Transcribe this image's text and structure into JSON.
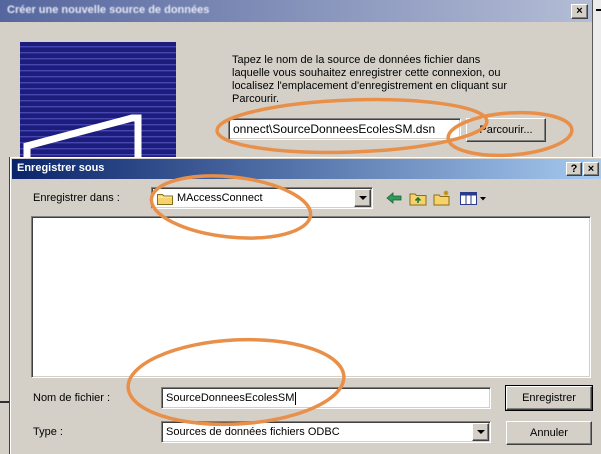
{
  "back_dialog": {
    "title": "Créer une nouvelle source de données",
    "close_glyph": "×",
    "illustration_icon": "wizard-illustration",
    "instructions": [
      "Tapez le nom de la source de données fichier dans",
      "laquelle vous souhaitez enregistrer cette connexion, ou",
      "localisez l'emplacement d'enregistrement en cliquant sur",
      "Parcourir."
    ],
    "path_value": "onnect\\SourceDonneesEcolesSM.dsn",
    "browse_label": "Parcourir..."
  },
  "save_dialog": {
    "title": "Enregistrer sous",
    "help_glyph": "?",
    "close_glyph": "×",
    "save_in": {
      "label": "Enregistrer dans :",
      "value": "MAccessConnect",
      "icon": "folder-icon"
    },
    "toolbar": [
      {
        "icon": "back-arrow-icon"
      },
      {
        "icon": "up-folder-icon"
      },
      {
        "icon": "new-folder-icon"
      },
      {
        "icon": "view-menu-icon"
      }
    ],
    "filename": {
      "label": "Nom de fichier :",
      "value": "SourceDonneesEcolesSM"
    },
    "type": {
      "label": "Type :",
      "value": "Sources de données fichiers ODBC"
    },
    "save_label": "Enregistrer",
    "cancel_label": "Annuler"
  },
  "annotations": {
    "color": "#e8904a"
  }
}
